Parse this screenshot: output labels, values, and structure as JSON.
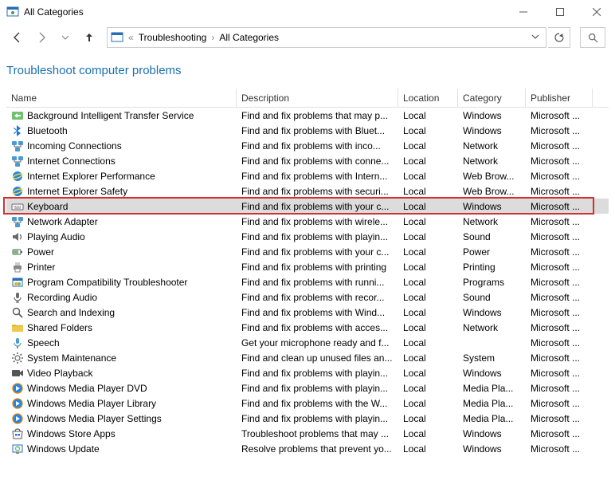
{
  "window": {
    "title": "All Categories"
  },
  "nav": {
    "breadcrumb": {
      "root_symbol": "«",
      "items": [
        "Troubleshooting",
        "All Categories"
      ]
    },
    "search_placeholder": ""
  },
  "heading": "Troubleshoot computer problems",
  "columns": [
    "Name",
    "Description",
    "Location",
    "Category",
    "Publisher"
  ],
  "highlighted_index": 6,
  "rows": [
    {
      "icon": "transfer-icon",
      "name": "Background Intelligent Transfer Service",
      "desc": "Find and fix problems that may p...",
      "loc": "Local",
      "cat": "Windows",
      "pub": "Microsoft ..."
    },
    {
      "icon": "bluetooth-icon",
      "name": "Bluetooth",
      "desc": "Find and fix problems with Bluet...",
      "loc": "Local",
      "cat": "Windows",
      "pub": "Microsoft ..."
    },
    {
      "icon": "network-icon",
      "name": "Incoming Connections",
      "desc": "Find and fix problems with inco...",
      "loc": "Local",
      "cat": "Network",
      "pub": "Microsoft ..."
    },
    {
      "icon": "network-icon",
      "name": "Internet Connections",
      "desc": "Find and fix problems with conne...",
      "loc": "Local",
      "cat": "Network",
      "pub": "Microsoft ..."
    },
    {
      "icon": "ie-icon",
      "name": "Internet Explorer Performance",
      "desc": "Find and fix problems with Intern...",
      "loc": "Local",
      "cat": "Web Brow...",
      "pub": "Microsoft ..."
    },
    {
      "icon": "ie-icon",
      "name": "Internet Explorer Safety",
      "desc": "Find and fix problems with securi...",
      "loc": "Local",
      "cat": "Web Brow...",
      "pub": "Microsoft ..."
    },
    {
      "icon": "keyboard-icon",
      "name": "Keyboard",
      "desc": "Find and fix problems with your c...",
      "loc": "Local",
      "cat": "Windows",
      "pub": "Microsoft ..."
    },
    {
      "icon": "network-icon",
      "name": "Network Adapter",
      "desc": "Find and fix problems with wirele...",
      "loc": "Local",
      "cat": "Network",
      "pub": "Microsoft ..."
    },
    {
      "icon": "speaker-icon",
      "name": "Playing Audio",
      "desc": "Find and fix problems with playin...",
      "loc": "Local",
      "cat": "Sound",
      "pub": "Microsoft ..."
    },
    {
      "icon": "power-icon",
      "name": "Power",
      "desc": "Find and fix problems with your c...",
      "loc": "Local",
      "cat": "Power",
      "pub": "Microsoft ..."
    },
    {
      "icon": "printer-icon",
      "name": "Printer",
      "desc": "Find and fix problems with printing",
      "loc": "Local",
      "cat": "Printing",
      "pub": "Microsoft ..."
    },
    {
      "icon": "compat-icon",
      "name": "Program Compatibility Troubleshooter",
      "desc": "Find and fix problems with runni...",
      "loc": "Local",
      "cat": "Programs",
      "pub": "Microsoft ..."
    },
    {
      "icon": "mic-icon",
      "name": "Recording Audio",
      "desc": "Find and fix problems with recor...",
      "loc": "Local",
      "cat": "Sound",
      "pub": "Microsoft ..."
    },
    {
      "icon": "search-icon",
      "name": "Search and Indexing",
      "desc": "Find and fix problems with Wind...",
      "loc": "Local",
      "cat": "Windows",
      "pub": "Microsoft ..."
    },
    {
      "icon": "folder-icon",
      "name": "Shared Folders",
      "desc": "Find and fix problems with acces...",
      "loc": "Local",
      "cat": "Network",
      "pub": "Microsoft ..."
    },
    {
      "icon": "speech-icon",
      "name": "Speech",
      "desc": "Get your microphone ready and f...",
      "loc": "Local",
      "cat": "",
      "pub": "Microsoft ..."
    },
    {
      "icon": "gear-icon",
      "name": "System Maintenance",
      "desc": "Find and clean up unused files an...",
      "loc": "Local",
      "cat": "System",
      "pub": "Microsoft ..."
    },
    {
      "icon": "video-icon",
      "name": "Video Playback",
      "desc": "Find and fix problems with playin...",
      "loc": "Local",
      "cat": "Windows",
      "pub": "Microsoft ..."
    },
    {
      "icon": "wmp-icon",
      "name": "Windows Media Player DVD",
      "desc": "Find and fix problems with playin...",
      "loc": "Local",
      "cat": "Media Pla...",
      "pub": "Microsoft ..."
    },
    {
      "icon": "wmp-icon",
      "name": "Windows Media Player Library",
      "desc": "Find and fix problems with the W...",
      "loc": "Local",
      "cat": "Media Pla...",
      "pub": "Microsoft ..."
    },
    {
      "icon": "wmp-icon",
      "name": "Windows Media Player Settings",
      "desc": "Find and fix problems with playin...",
      "loc": "Local",
      "cat": "Media Pla...",
      "pub": "Microsoft ..."
    },
    {
      "icon": "store-icon",
      "name": "Windows Store Apps",
      "desc": "Troubleshoot problems that may ...",
      "loc": "Local",
      "cat": "Windows",
      "pub": "Microsoft ..."
    },
    {
      "icon": "update-icon",
      "name": "Windows Update",
      "desc": "Resolve problems that prevent yo...",
      "loc": "Local",
      "cat": "Windows",
      "pub": "Microsoft ..."
    }
  ]
}
